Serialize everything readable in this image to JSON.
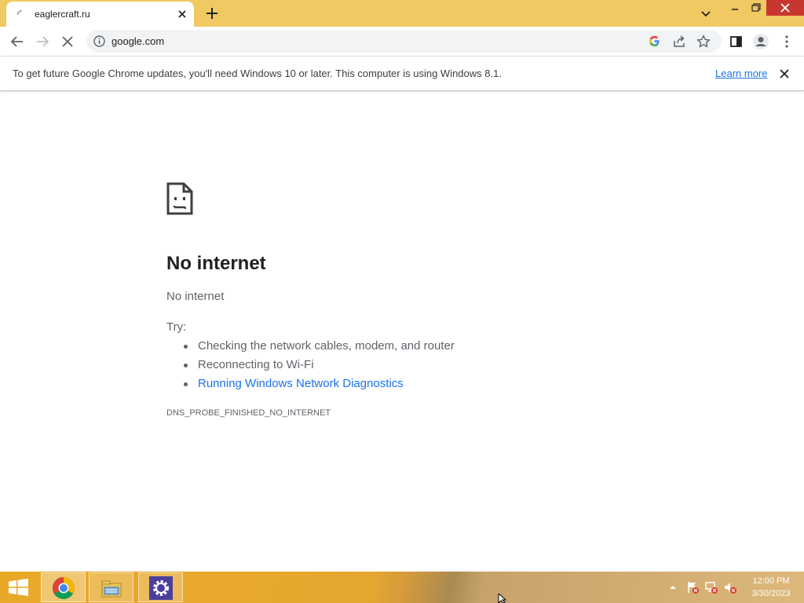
{
  "tab": {
    "title": "eaglercraft.ru"
  },
  "omnibox": {
    "url": "google.com"
  },
  "infobar": {
    "message": "To get future Google Chrome updates, you'll need Windows 10 or later. This computer is using Windows 8.1.",
    "learn_more": "Learn more"
  },
  "error": {
    "heading": "No internet",
    "subheading": "No internet",
    "try_label": "Try:",
    "suggestions": [
      "Checking the network cables, modem, and router",
      "Reconnecting to Wi-Fi",
      "Running Windows Network Diagnostics"
    ],
    "code": "DNS_PROBE_FINISHED_NO_INTERNET"
  },
  "taskbar": {
    "apps": [
      "chrome-icon",
      "file-explorer-icon",
      "settings-gear-icon"
    ],
    "time": "12:00 PM",
    "date": "3/30/2023"
  },
  "colors": {
    "tabstrip": "#f0c963",
    "link": "#1a73e8",
    "window_close": "#c7372f"
  }
}
